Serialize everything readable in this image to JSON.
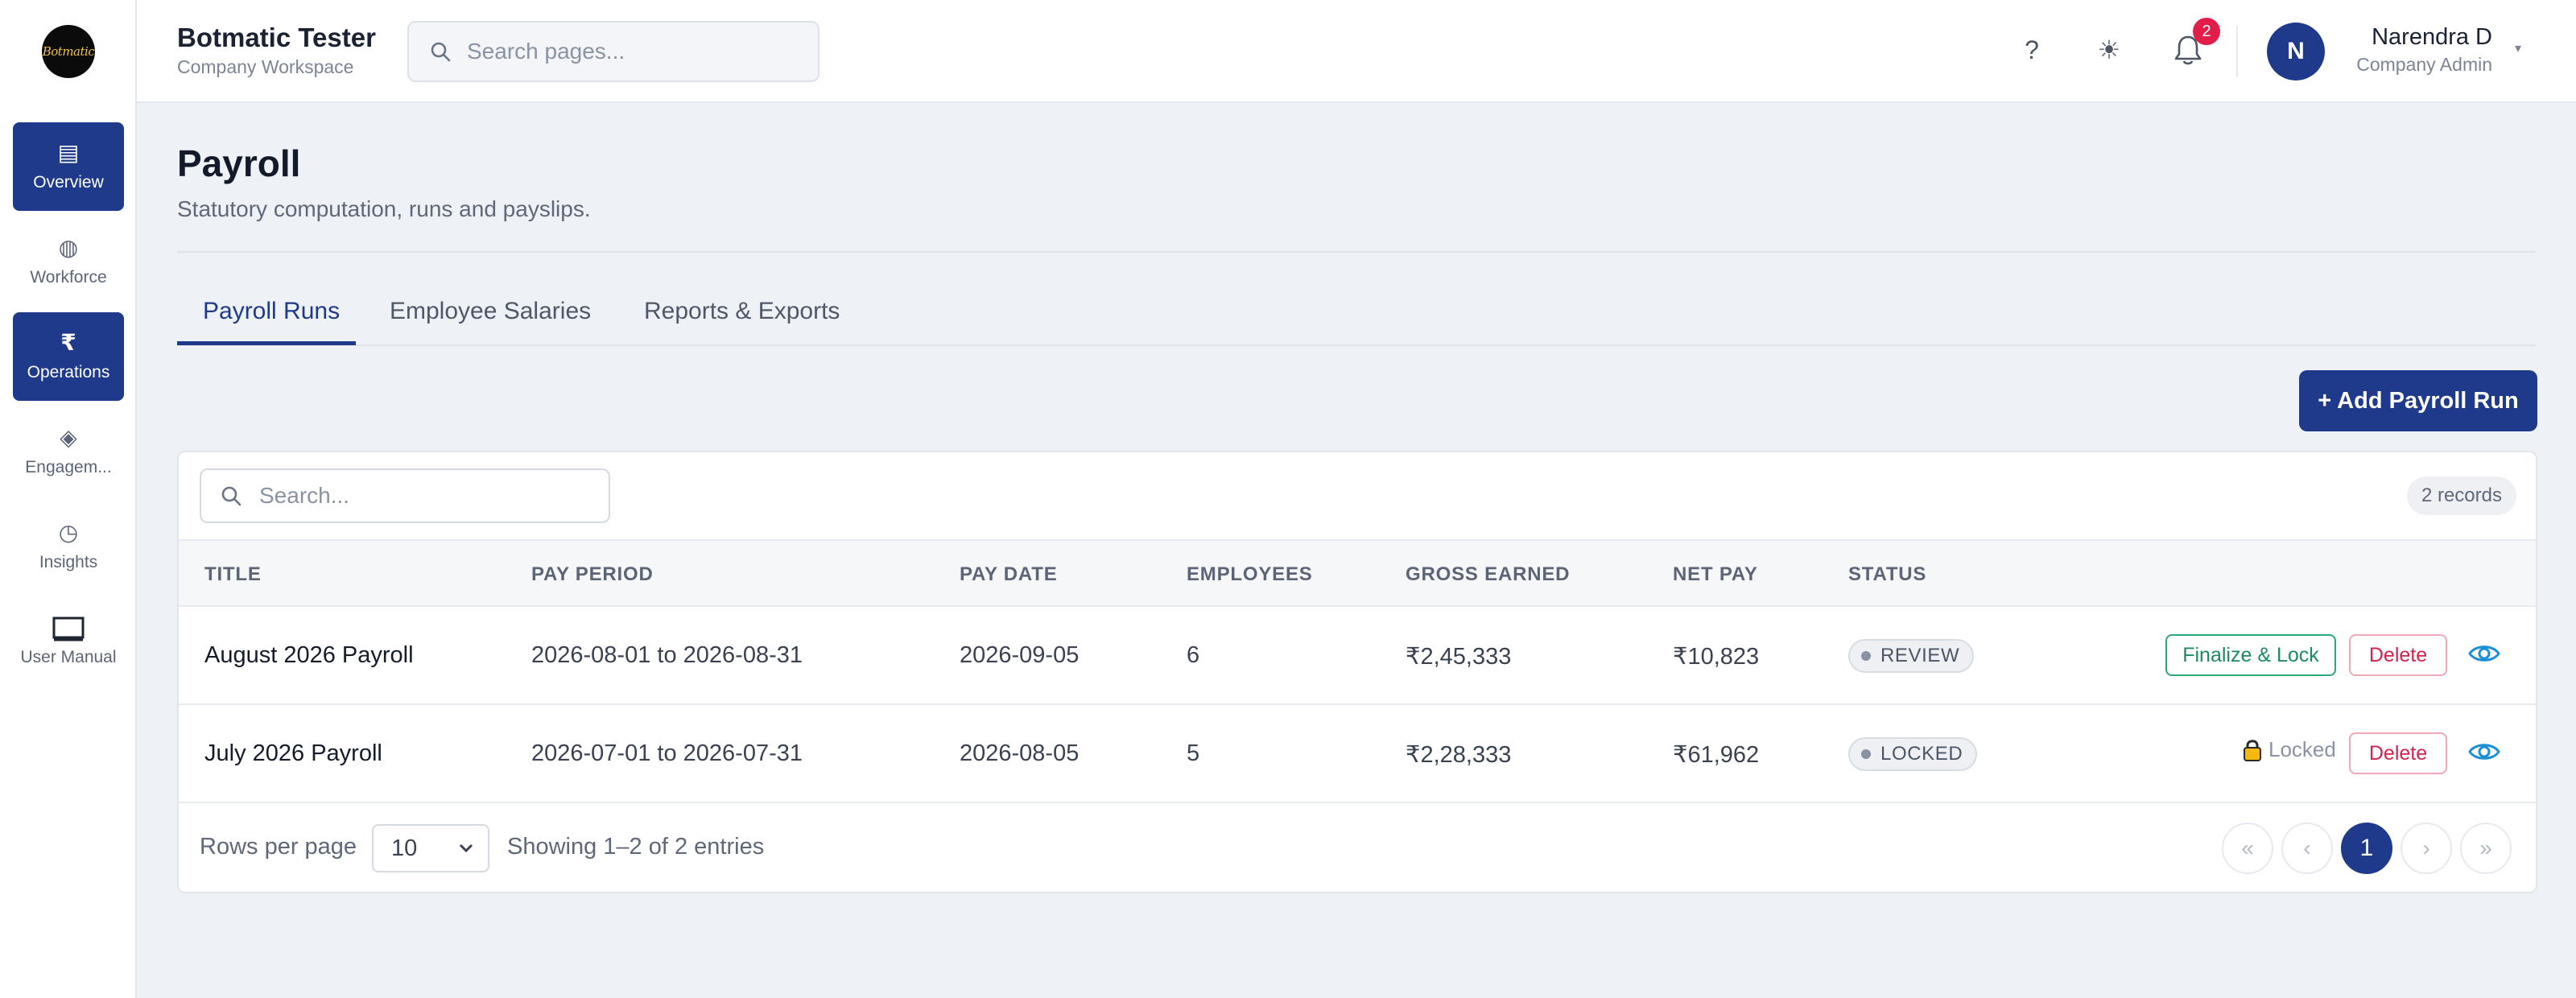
{
  "app": {
    "logo_text": "Botmatic",
    "title": "Botmatic Tester",
    "subtitle": "Company Workspace"
  },
  "header": {
    "search_placeholder": "Search pages...",
    "help_icon": "help-icon",
    "theme_icon": "sun-icon",
    "notification_count": "2",
    "avatar_initial": "N",
    "user_name": "Narendra D",
    "user_role": "Company Admin"
  },
  "sidebar": {
    "items": [
      {
        "label": "Overview",
        "icon": "list-icon",
        "glyph": "▤"
      },
      {
        "label": "Workforce",
        "icon": "globe-icon",
        "glyph": "◍"
      },
      {
        "label": "Operations",
        "icon": "rupee-icon",
        "glyph": "₹"
      },
      {
        "label": "Engagem...",
        "icon": "diamond-icon",
        "glyph": "◈"
      },
      {
        "label": "Insights",
        "icon": "pie-chart-icon",
        "glyph": "◷"
      },
      {
        "label": "User Manual",
        "icon": "book-icon",
        "glyph": ""
      }
    ]
  },
  "page": {
    "title": "Payroll",
    "subtitle": "Statutory computation, runs and payslips."
  },
  "tabs": [
    {
      "label": "Payroll Runs"
    },
    {
      "label": "Employee Salaries"
    },
    {
      "label": "Reports & Exports"
    }
  ],
  "actions": {
    "add_run_label": "+ Add Payroll Run"
  },
  "table": {
    "search_placeholder": "Search...",
    "records_label": "2 records",
    "columns": [
      "TITLE",
      "PAY PERIOD",
      "PAY DATE",
      "EMPLOYEES",
      "GROSS EARNED",
      "NET PAY",
      "STATUS"
    ],
    "rows": [
      {
        "title": "August 2026 Payroll",
        "pay_period": "2026-08-01 to 2026-08-31",
        "pay_date": "2026-09-05",
        "employees": "6",
        "gross_earned": "₹2,45,333",
        "net_pay": "₹10,823",
        "status": "REVIEW",
        "finalize_label": "Finalize & Lock",
        "delete_label": "Delete"
      },
      {
        "title": "July 2026 Payroll",
        "pay_period": "2026-07-01 to 2026-07-31",
        "pay_date": "2026-08-05",
        "employees": "5",
        "gross_earned": "₹2,28,333",
        "net_pay": "₹61,962",
        "status": "LOCKED",
        "locked_label": "Locked",
        "delete_label": "Delete"
      }
    ]
  },
  "pagination": {
    "rows_per_page_label": "Rows per page",
    "rows_per_page_value": "10",
    "showing_label": "Showing 1–2 of 2 entries",
    "first": "«",
    "prev": "‹",
    "current_page": "1",
    "next": "›",
    "last": "»"
  },
  "colors": {
    "primary": "#1f3a8a",
    "badge": "#e11d48",
    "finalize": "#1e8a5f",
    "delete": "#d4234a",
    "view": "#1d8fd6"
  }
}
